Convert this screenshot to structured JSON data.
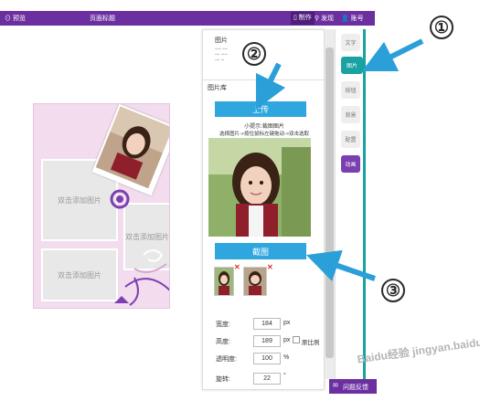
{
  "topbar": {
    "preview": "预览",
    "title": "页面标题",
    "make": "制作",
    "publish": "发现",
    "account": "账号"
  },
  "canvas": {
    "add_image_label": "双击添加图片"
  },
  "panel": {
    "section_title": "图片",
    "library_label": "图片库",
    "upload_button": "上传",
    "hint_title": "小提示:裁图图片",
    "hint_text": "选择图片->按住鼠标左键拖动->双击选取",
    "crop_button": "截图",
    "fields": [
      {
        "label": "宽度:",
        "value": "184",
        "unit": "px"
      },
      {
        "label": "高度:",
        "value": "189",
        "unit": "px"
      },
      {
        "label": "透明度:",
        "value": "100",
        "unit": "%"
      },
      {
        "label": "旋转:",
        "value": "22",
        "unit": "°"
      }
    ],
    "ratio_label": "原比例"
  },
  "side_tabs": [
    "文字",
    "图片",
    "按钮",
    "背景",
    "配置",
    "动画"
  ],
  "feedback": "问题反馈",
  "markers": [
    "①",
    "②",
    "③"
  ],
  "watermark": "Baidu经验 jingyan.baidu.com",
  "colors": {
    "purple": "#6b2fa0",
    "teal": "#1aa1a1",
    "blue": "#2fa7de"
  }
}
